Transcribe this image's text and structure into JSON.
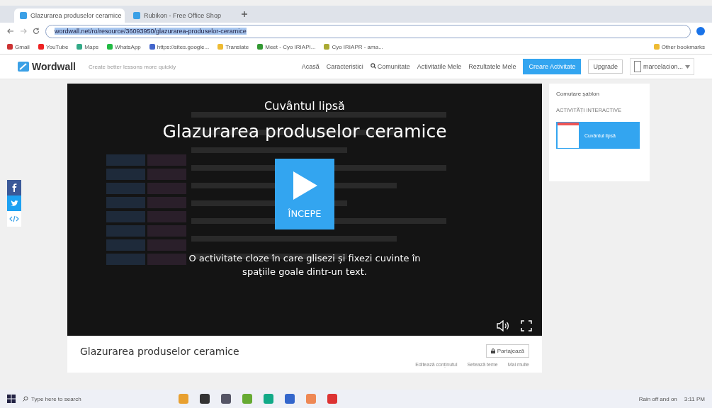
{
  "browser": {
    "tabs": [
      {
        "label": "Glazurarea produselor ceramice",
        "selected": true
      },
      {
        "label": "Rubikon - Free Office Shop",
        "selected": false
      }
    ],
    "address": "wordwall.net/ro/resource/36093950/glazurarea-produselor-ceramice",
    "bookmarks": [
      "Gmail",
      "YouTube",
      "Maps",
      "WhatsApp",
      "https://sites.google...",
      "Translate",
      "Meet - Cyo IRIAPI...",
      "Cyo IRIAPR - ama..."
    ],
    "other_bookmarks": "Other bookmarks"
  },
  "site": {
    "logo": "Wordwall",
    "tagline": "Create better lessons more quickly",
    "nav": [
      "Acasă",
      "Caracteristici",
      "Comunitate",
      "Activitatile Mele",
      "Rezultatele Mele"
    ],
    "create_button": "Creare Activitate",
    "upgrade_button": "Upgrade",
    "user": "marcelacion..."
  },
  "video": {
    "template": "Cuvântul lipsă",
    "title": "Glazurarea produselor ceramice",
    "start": "ÎNCEPE",
    "description": "O activitate cloze în care glisezi și fixezi cuvinte în spațiile goale dintr-un text."
  },
  "activity": {
    "title": "Glazurarea produselor ceramice",
    "share": "Partajează",
    "actions": [
      "Editează conținutul",
      "Setează teme",
      "Mai multe"
    ]
  },
  "side_panel": {
    "title": "Comutare șablon",
    "section": "ACTIVITĂȚI INTERACTIVE",
    "template": "Cuvântul lipsă"
  },
  "taskbar": {
    "search_placeholder": "Type here to search",
    "weather": "Rain off and on",
    "time": "3:11 PM"
  }
}
